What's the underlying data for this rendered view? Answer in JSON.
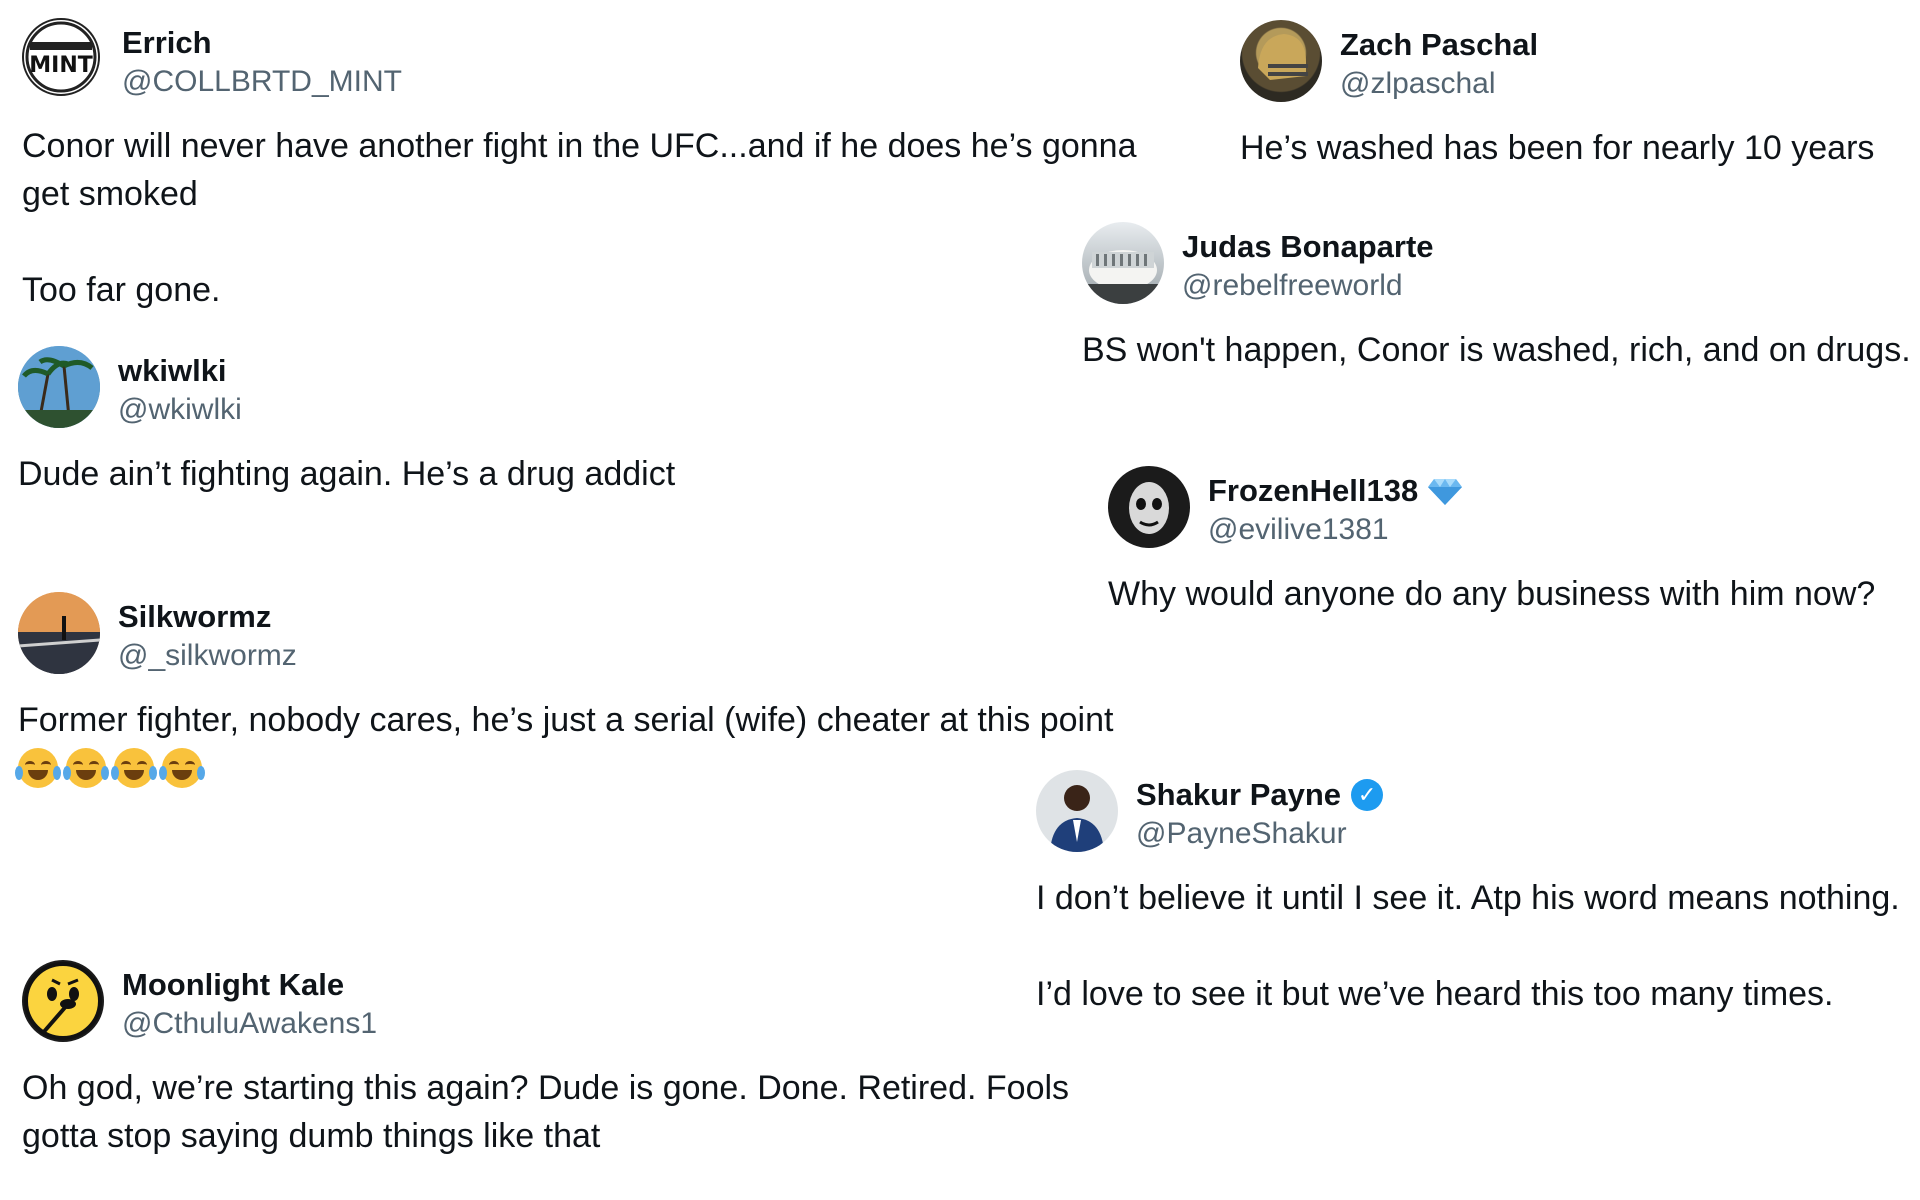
{
  "tweets": [
    {
      "name": "Errich",
      "handle": "@COLLBRTD_MINT",
      "avatar_text": "MINT",
      "body": [
        "Conor will never have another fight in the UFC...and if he does he’s gonna",
        "get smoked"
      ],
      "body2": [
        "Too far gone."
      ]
    },
    {
      "name": "Zach Paschal",
      "handle": "@zlpaschal",
      "body": [
        "He’s washed has been for nearly 10 years"
      ]
    },
    {
      "name": "Judas Bonaparte",
      "handle": "@rebelfreeworld",
      "body": [
        "BS won't happen, Conor is washed, rich, and on drugs."
      ]
    },
    {
      "name": "wkiwlki",
      "handle": "@wkiwlki",
      "body": [
        "Dude ain’t fighting again. He’s a drug addict"
      ]
    },
    {
      "name": "FrozenHell138",
      "handle": "@evilive1381",
      "badge": "gem-icon",
      "body": [
        "Why would anyone do any business with him now?"
      ]
    },
    {
      "name": "Silkwormz",
      "handle": "@_silkwormz",
      "body": [
        "Former fighter, nobody cares, he’s just a serial (wife) cheater at this point"
      ],
      "emoji": [
        "joy-emoji",
        "joy-emoji",
        "joy-emoji",
        "joy-emoji"
      ]
    },
    {
      "name": "Shakur Payne",
      "handle": "@PayneShakur",
      "badge": "verified-icon",
      "body": [
        "I don’t believe it until I see it. Atp his word means nothing."
      ],
      "body2": [
        "I’d love to see it but we’ve heard this too many times."
      ]
    },
    {
      "name": "Moonlight Kale",
      "handle": "@CthuluAwakens1",
      "body": [
        "Oh god, we’re starting this again? Dude is gone. Done. Retired. Fools",
        "gotta stop saying dumb things like that"
      ]
    }
  ],
  "colors": {
    "text": "#0f1419",
    "handle": "#536471",
    "verified": "#1d9bf0"
  }
}
